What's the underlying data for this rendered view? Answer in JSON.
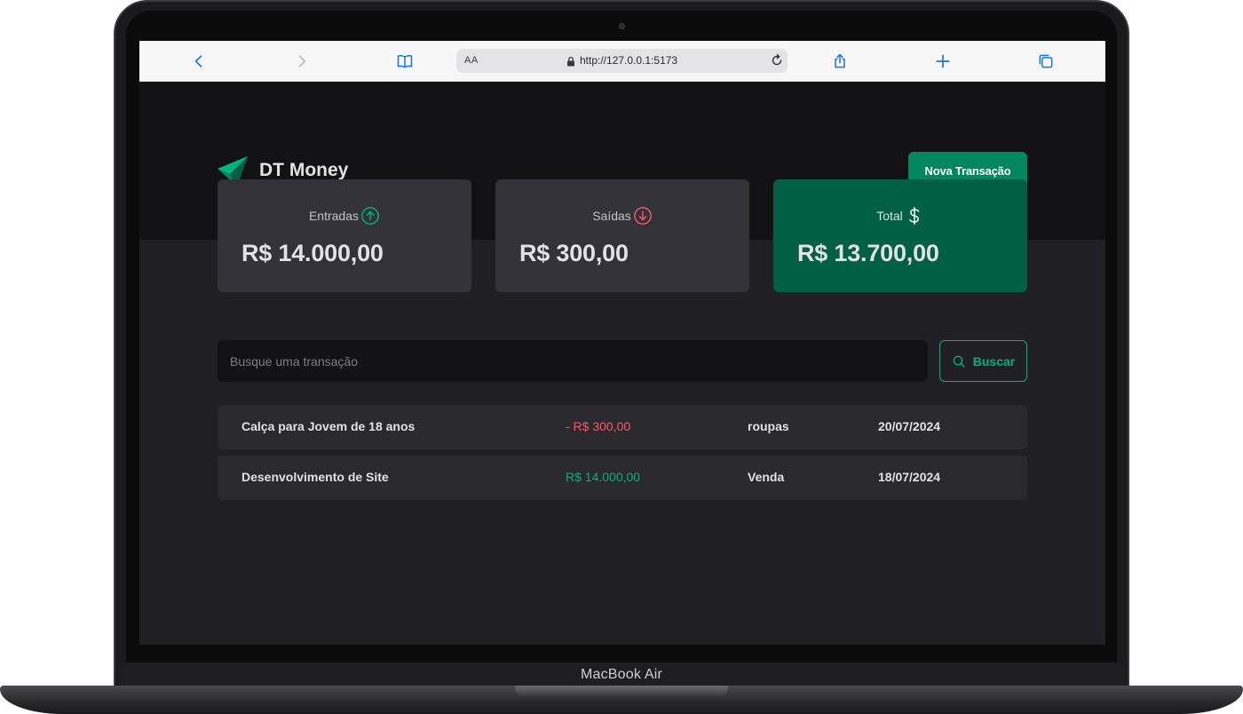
{
  "device": {
    "model_label": "MacBook Air"
  },
  "browser": {
    "text_size_label": "AA",
    "url": "http://127.0.0.1:5173",
    "icons": [
      "back-icon",
      "forward-icon",
      "bookmarks-icon",
      "lock-icon",
      "reload-icon",
      "share-icon",
      "new-tab-icon",
      "tabs-icon"
    ]
  },
  "app": {
    "title": "DT Money",
    "new_transaction_label": "Nova Transação",
    "colors": {
      "brand": "#00875f",
      "brand_dark": "#015f43",
      "income": "#00b37e",
      "outcome": "#f75a68"
    }
  },
  "summary": {
    "income": {
      "label": "Entradas",
      "value": "R$ 14.000,00",
      "icon": "arrow-circle-up-icon"
    },
    "outcome": {
      "label": "Saídas",
      "value": "R$ 300,00",
      "icon": "arrow-circle-down-icon"
    },
    "total": {
      "label": "Total",
      "value": "R$ 13.700,00",
      "icon": "dollar-sign-icon"
    }
  },
  "search": {
    "placeholder": "Busque uma transação",
    "value": "",
    "button_label": "Buscar"
  },
  "transactions": [
    {
      "description": "Calça para Jovem de 18 anos",
      "price": "- R$ 300,00",
      "type": "outcome",
      "category": "roupas",
      "date": "20/07/2024"
    },
    {
      "description": "Desenvolvimento de Site",
      "price": "R$ 14.000,00",
      "type": "income",
      "category": "Venda",
      "date": "18/07/2024"
    }
  ]
}
